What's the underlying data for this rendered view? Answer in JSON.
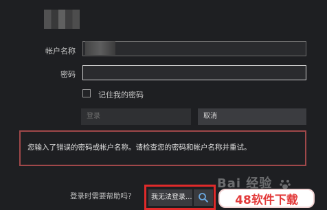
{
  "form": {
    "account_label": "帐户名称",
    "password_label": "密码",
    "remember_label": "记住我的密码",
    "login_button": "登录",
    "cancel_button": "取消"
  },
  "error": {
    "message": "您输入了错误的密码或帐户名称。请检查您的密码和帐户名称并重试。"
  },
  "help": {
    "label": "登录时需要帮助吗？",
    "cant_login_button": "我无法登录..."
  },
  "watermark": {
    "logo_text": "Bai 经验",
    "badge_text": "48软件下载"
  },
  "colors": {
    "background": "#1e1f22",
    "error_border": "#a0484a",
    "highlight_frame": "#e02a2a",
    "badge_text": "#e23a3a"
  },
  "icons": [
    "search-icon",
    "paw-icon"
  ]
}
